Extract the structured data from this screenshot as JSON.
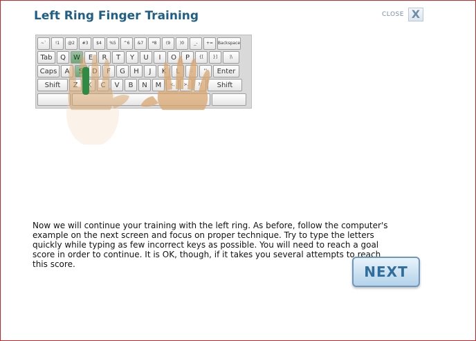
{
  "header": {
    "title": "Left Ring Finger Training",
    "close_label": "CLOSE",
    "close_glyph": "X"
  },
  "keyboard": {
    "rows": [
      [
        "~`",
        "!1",
        "@2",
        "#3",
        "$4",
        "%5",
        "^6",
        "&7",
        "*8",
        "(9",
        ")0",
        "_-",
        "+=",
        "Backspace"
      ],
      [
        "Tab",
        "Q",
        "W",
        "E",
        "R",
        "T",
        "Y",
        "U",
        "I",
        "O",
        "P",
        "{[",
        "}]",
        "|\\"
      ],
      [
        "Caps",
        "A",
        "S",
        "D",
        "F",
        "G",
        "H",
        "J",
        "K",
        "L",
        ":;",
        "\"'",
        "Enter"
      ],
      [
        "Shift",
        "Z",
        "X",
        "C",
        "V",
        "B",
        "N",
        "M",
        "<,",
        ">.",
        "?/",
        "Shift"
      ]
    ],
    "highlighted_keys": [
      "W",
      "S"
    ],
    "highlight_color": "#7fb388"
  },
  "description": "Now we will continue your training with the left ring. As before, follow the computer's example on the next screen and focus on proper technique. Try to type the letters quickly while typing as few incorrect keys as possible. You will need to reach a goal score in order to continue. It is OK, though, if it takes you several attempts to reach this score.",
  "next_button": {
    "label": "NEXT"
  },
  "colors": {
    "title": "#1f5f86",
    "frame_border": "#c8242b",
    "next_text": "#2f6e9c",
    "hand_skin": "#d9a66f"
  }
}
